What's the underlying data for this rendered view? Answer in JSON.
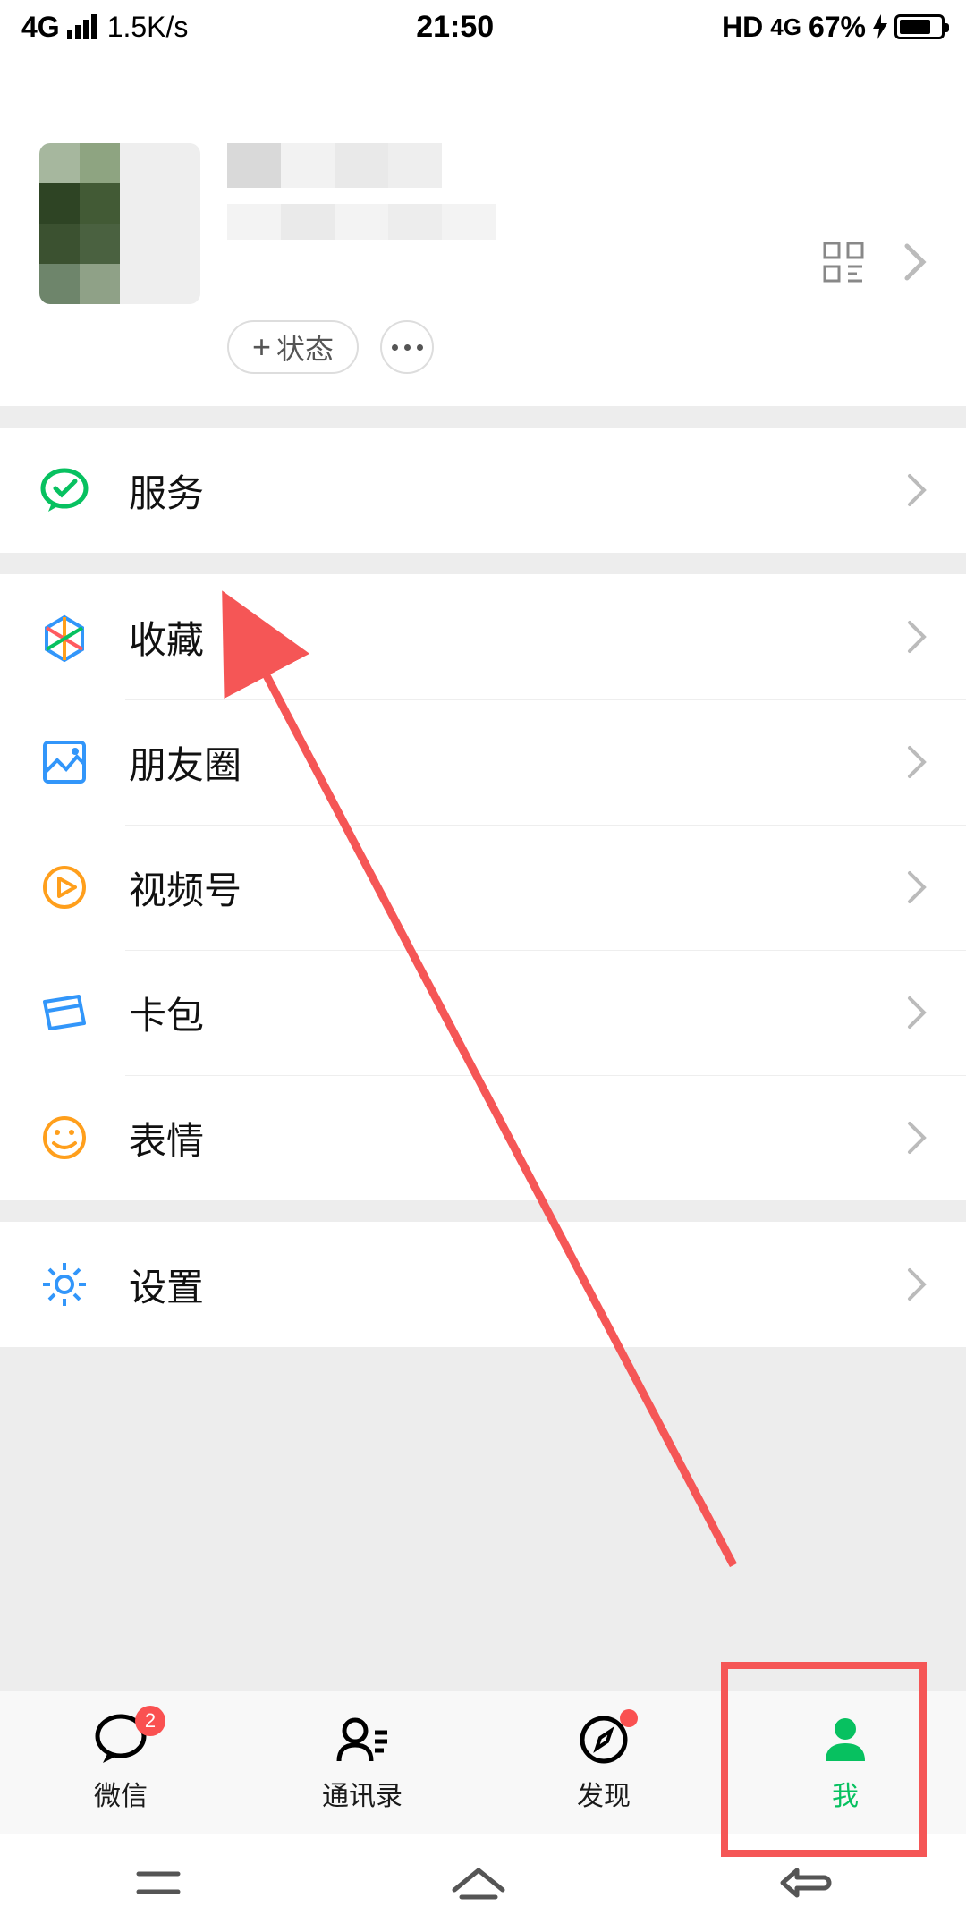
{
  "statusbar": {
    "network": "4G",
    "speed": "1.5K/s",
    "time": "21:50",
    "hd": "HD",
    "net2": "4G",
    "battery_pct": "67%"
  },
  "profile": {
    "status_chip": "状态",
    "qr_icon": "qr-icon",
    "chevron": "chevron"
  },
  "menu": {
    "service": "服务",
    "favorites": "收藏",
    "moments": "朋友圈",
    "channels": "视频号",
    "cards": "卡包",
    "stickers": "表情",
    "settings": "设置"
  },
  "tabs": {
    "chat": "微信",
    "chat_badge": "2",
    "contacts": "通讯录",
    "discover": "发现",
    "me": "我"
  },
  "colors": {
    "accent": "#07c160",
    "annotation": "#f55656"
  }
}
